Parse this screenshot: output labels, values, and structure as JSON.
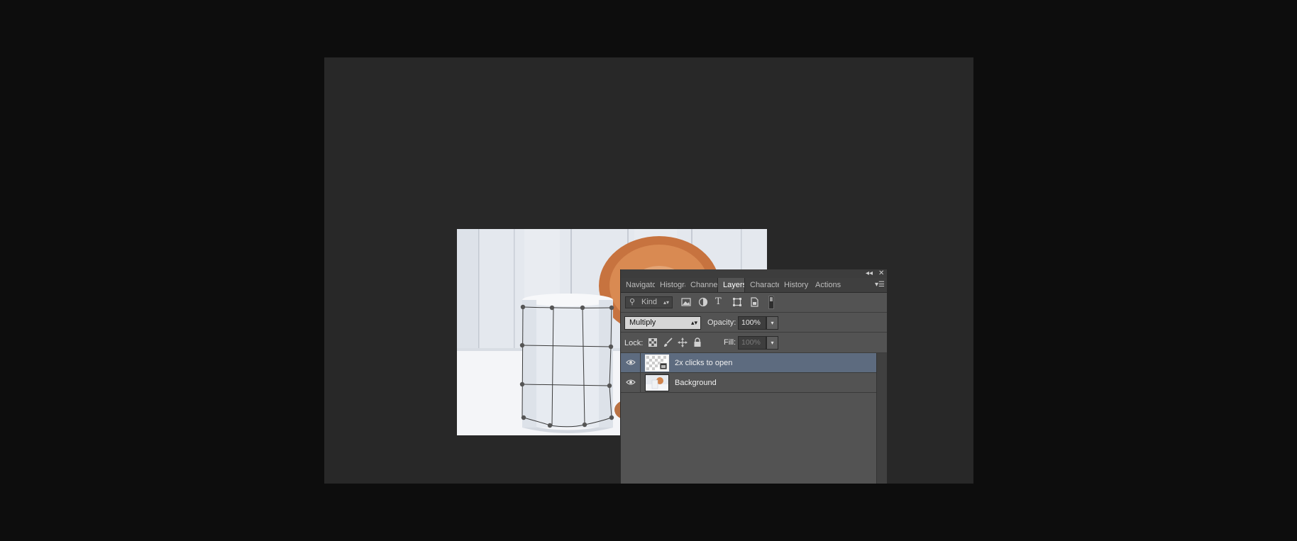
{
  "panel": {
    "controls": {
      "collapse": "◂◂",
      "close": "✕"
    },
    "tabs": [
      {
        "label": "Navigato",
        "active": false
      },
      {
        "label": "Histogra",
        "active": false
      },
      {
        "label": "Channels",
        "active": false
      },
      {
        "label": "Layers",
        "active": true
      },
      {
        "label": "Characte",
        "active": false
      },
      {
        "label": "History",
        "active": false
      },
      {
        "label": "Actions",
        "active": false
      }
    ],
    "menu_icon": "panel-menu-icon",
    "filter": {
      "kind_label": "Kind",
      "icons": [
        "image-filter-icon",
        "adjustment-filter-icon",
        "type-filter-icon",
        "shape-filter-icon",
        "smart-object-filter-icon"
      ],
      "type_glyph": "T"
    },
    "blend": {
      "mode": "Multiply",
      "opacity_label": "Opacity:",
      "opacity_value": "100%"
    },
    "lock": {
      "label": "Lock:",
      "fill_label": "Fill:",
      "fill_value": "100%"
    },
    "layers": [
      {
        "name": "2x clicks to open",
        "selected": true,
        "visible": true,
        "thumb": "smart-object-thumbnail"
      },
      {
        "name": "Background",
        "selected": false,
        "visible": true,
        "thumb": "photo-thumbnail"
      }
    ]
  },
  "colors": {
    "app_background": "#0d0d0d",
    "canvas_area": "#282828",
    "panel": "#535353",
    "selected_layer": "#5d6b7f"
  }
}
